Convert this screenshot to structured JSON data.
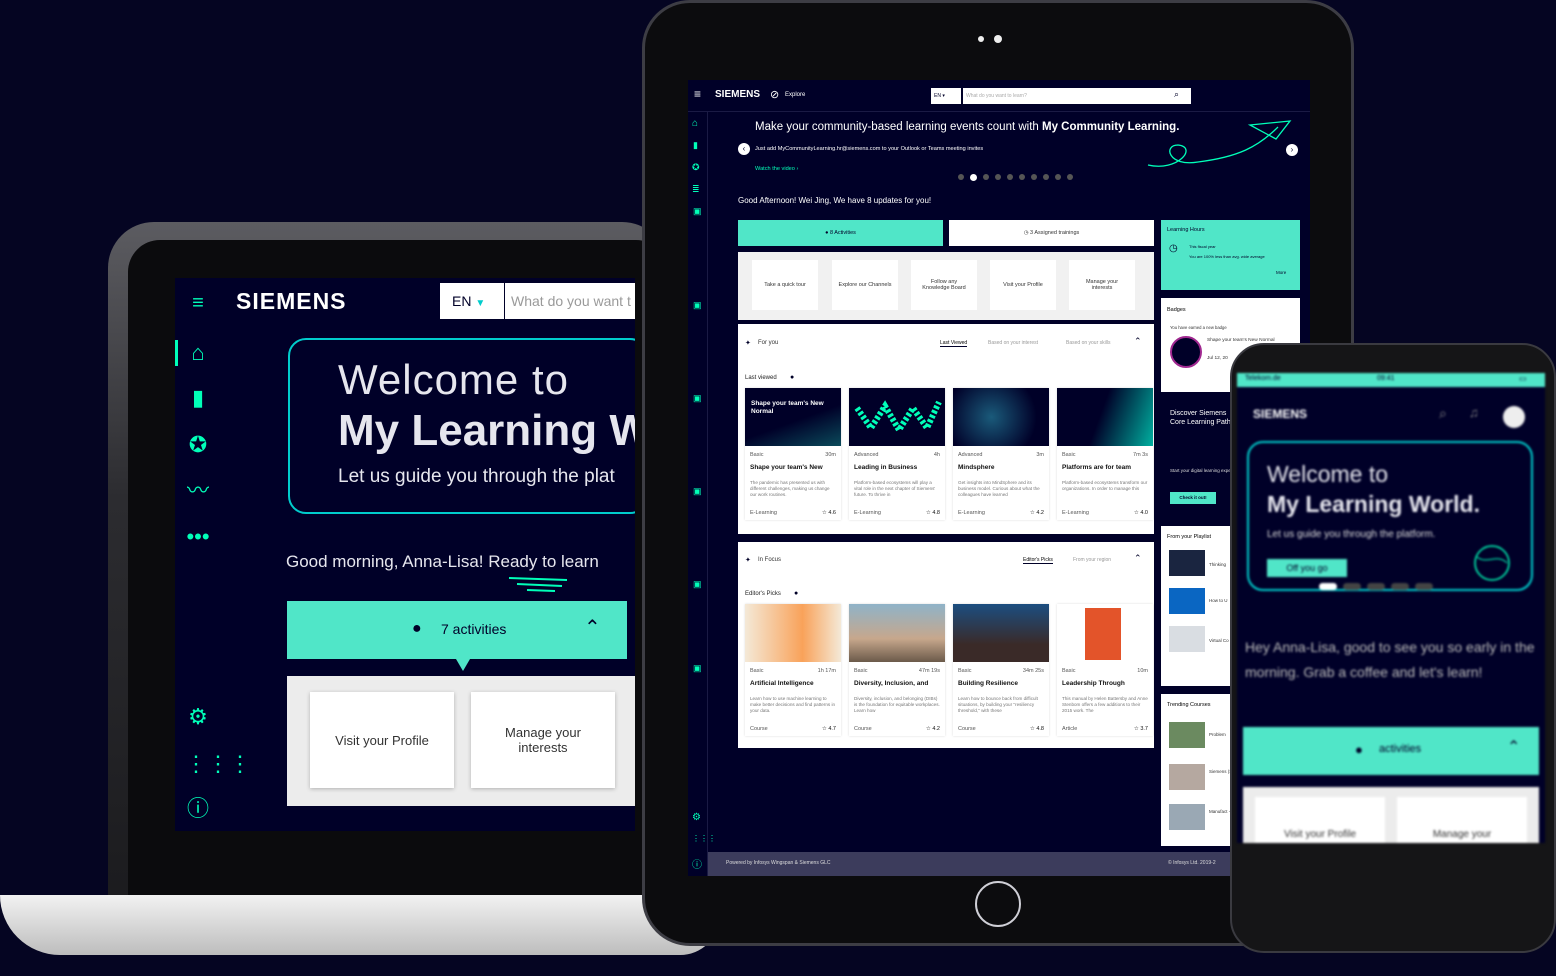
{
  "colors": {
    "navy": "#000028",
    "mint": "#50e6c8",
    "teal": "#00ffb9",
    "cyan": "#00cccc"
  },
  "laptop": {
    "brand": "SIEMENS",
    "lang": "EN",
    "search_placeholder": "What do you want t",
    "hero": {
      "line1": "Welcome to",
      "line2": "My Learning W",
      "line3": "Let us guide you through the plat"
    },
    "greeting": "Good morning, Anna-Lisa! Ready to learn",
    "activities": "7 activities",
    "cards": [
      "Visit your Profile",
      "Manage your interests"
    ]
  },
  "tablet": {
    "brand": "SIEMENS",
    "explore": "Explore",
    "lang": "EN",
    "search_placeholder": "What do you want to learn?",
    "banner": {
      "text": "Make your community-based learning events count with ",
      "bold": "My Community Learning.",
      "sub": "Just add MyCommunityLearning.hr@siemens.com to your Outlook or Teams meeting invites",
      "link": "Watch the video ›"
    },
    "greeting": "Good Afternoon! Wei Jing, We have 8 updates for you!",
    "tabs": [
      "8 Activities",
      "3 Assigned trainings"
    ],
    "quick": [
      "Take a quick tour",
      "Explore our Channels",
      "Follow any Knowledge Board",
      "Visit your Profile",
      "Manage your interests"
    ],
    "for_you": {
      "title": "For you",
      "tabs": [
        "Last Viewed",
        "Based on your interest",
        "Based on your skills"
      ],
      "section": "Last viewed",
      "courses": [
        {
          "img_text": "Shape your team's New Normal",
          "level": "Basic",
          "time": "30m",
          "title": "Shape your team's New",
          "desc": "The pandemic has presented us with different challenges, making us change our work routines.",
          "type": "E-Learning",
          "rating": "4.6"
        },
        {
          "img_text": "",
          "level": "Advanced",
          "time": "4h",
          "title": "Leading in Business",
          "desc": "Platform-based ecosystems will play a vital role in the next chapter of Siemens' future. To thrive in",
          "type": "E-Learning",
          "rating": "4.8"
        },
        {
          "img_text": "",
          "level": "Advanced",
          "time": "3m",
          "title": "Mindsphere",
          "desc": "Get insights into MindSphere and its business model. Curious about what the colleagues have learned",
          "type": "E-Learning",
          "rating": "4.2"
        },
        {
          "img_text": "",
          "level": "Basic",
          "time": "7m 3s",
          "title": "Platforms are for team",
          "desc": "Platform-based ecosystems transform our organizations. In order to manage this",
          "type": "E-Learning",
          "rating": "4.0"
        }
      ]
    },
    "in_focus": {
      "title": "In Focus",
      "tabs": [
        "Editor's Picks",
        "From your region"
      ],
      "section": "Editor's Picks",
      "courses": [
        {
          "level": "Basic",
          "time": "1h 17m",
          "title": "Artificial Intelligence",
          "desc": "Learn how to use machine learning to make better decisions and find patterns in your data.",
          "type": "Course",
          "rating": "4.7"
        },
        {
          "level": "Basic",
          "time": "47m 19s",
          "title": "Diversity, Inclusion, and",
          "desc": "Diversity, inclusion, and belonging (DIBs) is the foundation for equitable workplaces. Learn how",
          "type": "Course",
          "rating": "4.2"
        },
        {
          "level": "Basic",
          "time": "34m 25s",
          "title": "Building Resilience",
          "desc": "Learn how to bounce back from difficult situations, by building your \"resiliency threshold,\" with these",
          "type": "Course",
          "rating": "4.8"
        },
        {
          "level": "Basic",
          "time": "10m",
          "title": "Leadership Through",
          "desc": "This manual by Helen Battersby and Anne Stenbom offers a few additions to their 2015 work. The",
          "type": "Article",
          "rating": "3.7"
        }
      ]
    },
    "right": {
      "hours_title": "Learning Hours",
      "hours_sub": "This fiscal year",
      "hours_text": "You are 100% less than avg. wide average",
      "more": "More",
      "badges_title": "Badges",
      "badges_text": "You have earned a new badge",
      "badge_name": "Shape your team's New Normal",
      "badge_date": "Jul 12, 20",
      "discover": "Discover Siemens Core Learning Paths.",
      "discover_sub": "Start your digital learning experience now.",
      "check": "Check it out!",
      "playlist": "From your Playlist",
      "playlist_items": [
        "Thinking",
        "How to U",
        "Virtual Co"
      ],
      "trending": "Trending Courses",
      "trending_items": [
        "Problem",
        "Siemens (SDS) Co",
        "Manufact - Advanc"
      ]
    },
    "footer_left": "Powered by Infosys Wingspan & Siemens GLC",
    "footer_right": "© Infosys Ltd. 2019-2"
  },
  "phone": {
    "status_left": "Telekom.de",
    "status_time": "09:41",
    "brand": "SIEMENS",
    "hero": {
      "line1": "Welcome to",
      "line2": "My Learning World.",
      "line3": "Let us guide you through the platform.",
      "button": "Off you go"
    },
    "greeting": "Hey Anna-Lisa, good to see you so early in the morning. Grab a coffee and let's learn!",
    "activities": "activities",
    "cards": [
      "Visit your Profile",
      "Manage your"
    ]
  }
}
